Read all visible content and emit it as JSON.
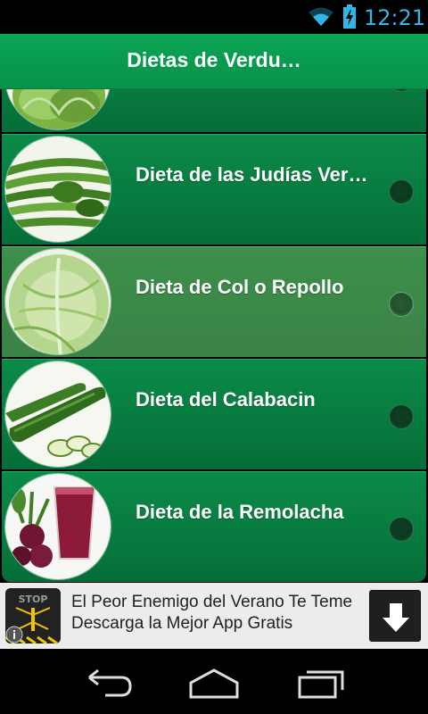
{
  "status_bar": {
    "time": "12:21",
    "icons": [
      "wifi-icon",
      "battery-charging-icon"
    ],
    "color": "#33b5e5"
  },
  "action_bar": {
    "title": "Dietas de Verdu…",
    "color": "#0aa555"
  },
  "list": {
    "items": [
      {
        "label": "",
        "thumbnail": "lettuce-image",
        "selected": false
      },
      {
        "label": "Dieta de las Judías Ver…",
        "thumbnail": "green-beans-image",
        "selected": false
      },
      {
        "label": "Dieta de Col o Repollo",
        "thumbnail": "cabbage-image",
        "selected": true
      },
      {
        "label": "Dieta del Calabacin",
        "thumbnail": "zucchini-image",
        "selected": false
      },
      {
        "label": "Dieta de la Remolacha",
        "thumbnail": "beet-juice-image",
        "selected": false
      }
    ]
  },
  "ad": {
    "text": "El Peor Enemigo del Verano Te Teme Descarga la Mejor App Gratis",
    "icon": "mosquito-app-icon",
    "info_icon": "info-icon",
    "download_icon": "download-arrow-icon"
  },
  "nav_bar": {
    "buttons": [
      "back-icon",
      "home-icon",
      "recent-apps-icon"
    ]
  }
}
